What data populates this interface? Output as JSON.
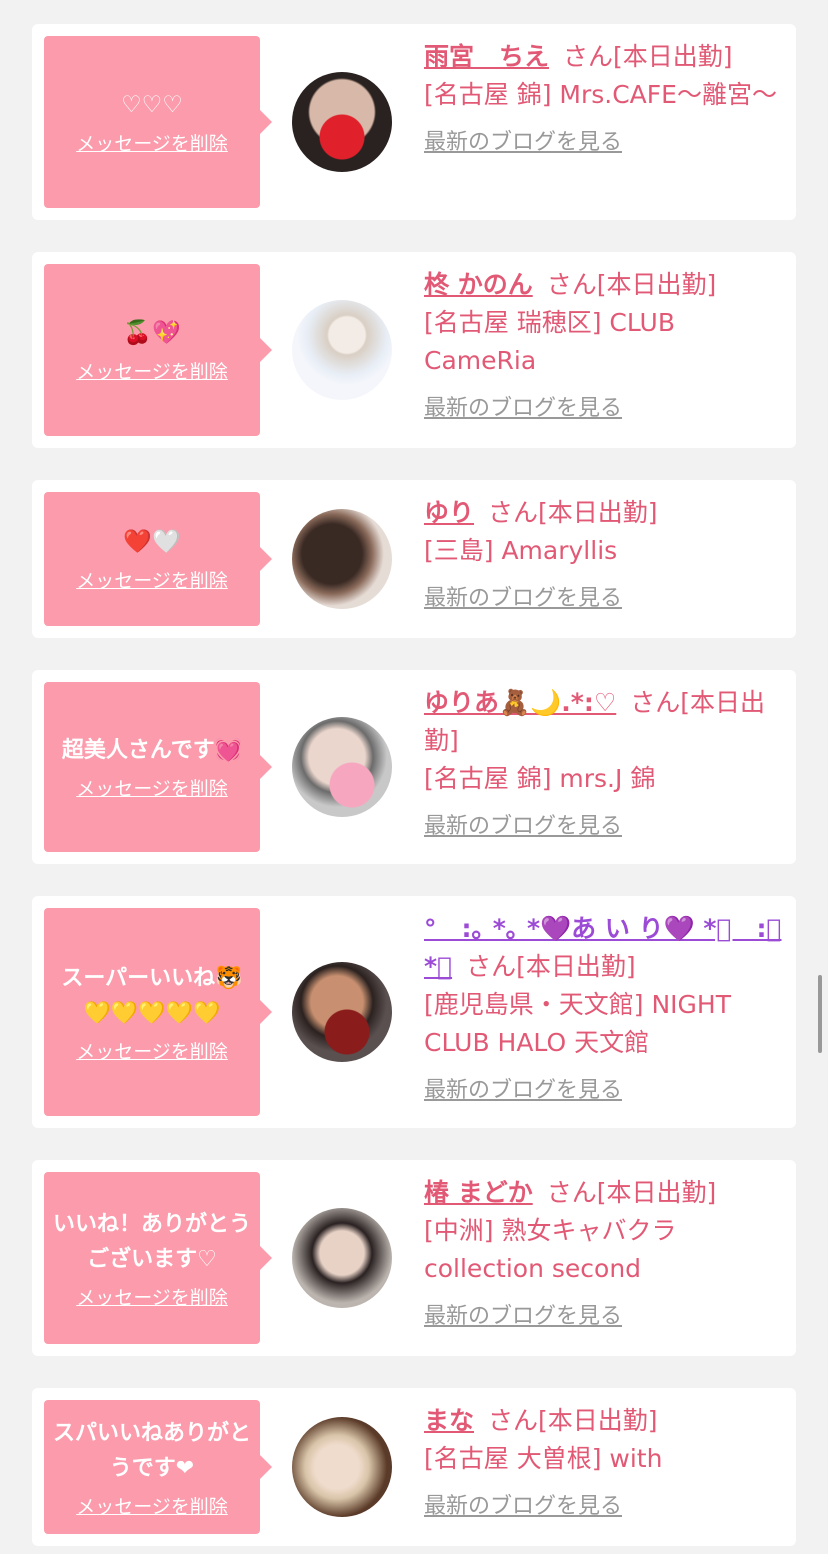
{
  "delete_label": "メッセージを削除",
  "blog_label": "最新のブログを見る",
  "cards": [
    {
      "message": "♡♡♡",
      "name": "雨宮　ちえ",
      "suffix": "さん[本日出勤]",
      "store": "[名古屋 錦] Mrs.CAFE〜離宮〜"
    },
    {
      "message": "🍒💖",
      "name": "柊 かのん",
      "suffix": "さん[本日出勤]",
      "store": "[名古屋 瑞穂区] CLUB CameRia"
    },
    {
      "message": "❤️🤍",
      "name": "ゆり",
      "suffix": "さん[本日出勤]",
      "store": "[三島] Amaryllis"
    },
    {
      "message": "超美人さんです💓",
      "name": "ゆりあ🧸🌙.*:♡",
      "suffix": "さん[本日出勤]",
      "store": "[名古屋 錦] mrs.J 錦"
    },
    {
      "message": "スーパーいいね🐯💛💛💛💛💛",
      "name": "°　:｡ *｡ *💜あ い り💜 *ﾟ　:｡*｡",
      "suffix": "さん[本日出勤]",
      "store": "[鹿児島県・天文館] NIGHT CLUB HALO 天文館"
    },
    {
      "message": "いいね！ありがとうございます♡",
      "name": "椿 まどか",
      "suffix": "さん[本日出勤]",
      "store": "[中洲] 熟女キャバクラ collection second"
    },
    {
      "message": "スパいいねありがとうです❤",
      "name": "まな",
      "suffix": "さん[本日出勤]",
      "store": "[名古屋 大曽根] with"
    }
  ],
  "colors": {
    "bubble": "#fb9bab",
    "accent": "#e25975",
    "background": "#f2f2f2"
  }
}
